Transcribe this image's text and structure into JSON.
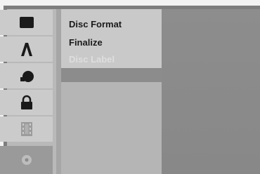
{
  "sidebar": {
    "items": [
      {
        "icon": "disc-square-icon",
        "selected": false
      },
      {
        "icon": "letter-a-icon",
        "selected": false
      },
      {
        "icon": "shapes-icon",
        "selected": false
      },
      {
        "icon": "lock-icon",
        "selected": false
      },
      {
        "icon": "film-icon",
        "selected": false
      },
      {
        "icon": "disc-icon",
        "selected": true
      }
    ]
  },
  "menu": {
    "items": [
      {
        "label": "Disc Format",
        "enabled": true
      },
      {
        "label": "Finalize",
        "enabled": true
      },
      {
        "label": "Disc Label",
        "enabled": false
      }
    ]
  }
}
